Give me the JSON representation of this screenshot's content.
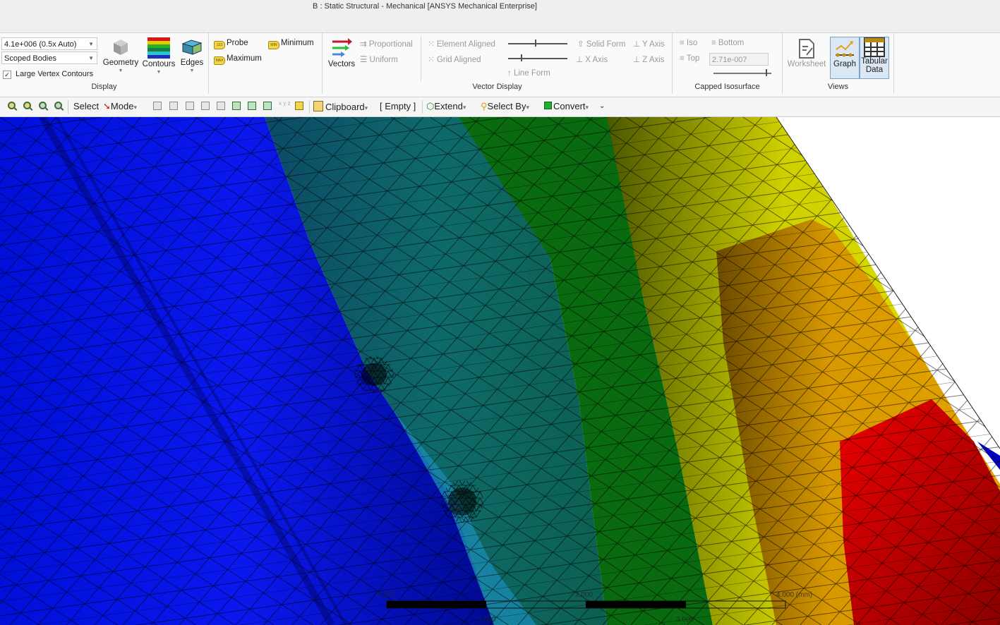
{
  "window": {
    "title": "B : Static Structural - Mechanical [ANSYS Mechanical Enterprise]"
  },
  "ribbon": {
    "display": {
      "scale_combo": "4.1e+006 (0.5x Auto)",
      "scope_combo": "Scoped Bodies",
      "large_vertex_contours": {
        "label": "Large Vertex Contours",
        "checked": true
      },
      "geometry": "Geometry",
      "contours": "Contours",
      "edges": "Edges",
      "group_label": "Display"
    },
    "probe": {
      "probe": "Probe",
      "minimum": "Minimum",
      "maximum": "Maximum",
      "probe_badge": "123",
      "min_badge": "MIN",
      "max_badge": "MAX"
    },
    "vector_display": {
      "vectors": "Vectors",
      "proportional": "Proportional",
      "uniform": "Uniform",
      "element_aligned": "Element Aligned",
      "grid_aligned": "Grid Aligned",
      "line_form": "Line Form",
      "solid_form": "Solid Form",
      "x_axis": "X Axis",
      "y_axis": "Y Axis",
      "z_axis": "Z Axis",
      "group_label": "Vector Display"
    },
    "capped_isosurface": {
      "iso": "Iso",
      "bottom": "Bottom",
      "top": "Top",
      "top_value": "2.71e-007",
      "group_label": "Capped Isosurface"
    },
    "views": {
      "worksheet": "Worksheet",
      "graph": "Graph",
      "tabular_line1": "Tabular",
      "tabular_line2": "Data",
      "group_label": "Views"
    }
  },
  "toolbar": {
    "select": "Select",
    "mode": "Mode",
    "clipboard": "Clipboard",
    "empty": "[ Empty ]",
    "extend": "Extend",
    "select_by": "Select By",
    "convert": "Convert",
    "dropdown_arrow": "▾"
  },
  "viewport": {
    "scale_bar": {
      "labels_top": [
        "0.000",
        "2.000",
        "4.000 (mm)"
      ],
      "labels_bottom": [
        "1.000",
        "3.000"
      ]
    },
    "contour_colors": [
      "#0000ff",
      "#00a0d0",
      "#008060",
      "#007a10",
      "#dada00",
      "#e8a000",
      "#ff0000"
    ]
  }
}
